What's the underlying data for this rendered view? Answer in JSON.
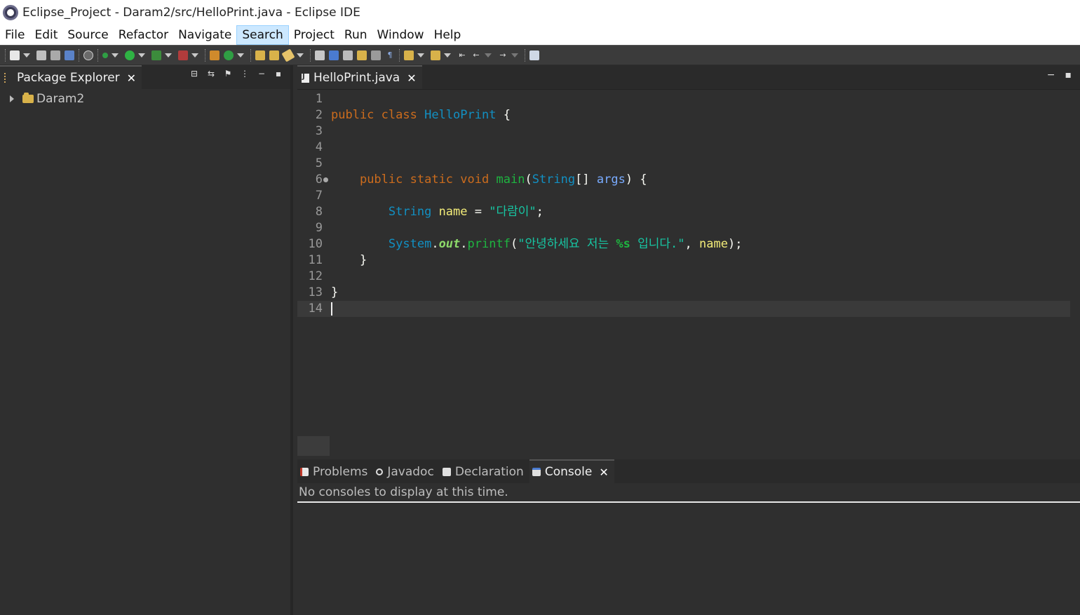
{
  "window": {
    "title": "Eclipse_Project - Daram2/src/HelloPrint.java - Eclipse IDE"
  },
  "menubar": {
    "items": [
      {
        "label": "File"
      },
      {
        "label": "Edit"
      },
      {
        "label": "Source"
      },
      {
        "label": "Refactor"
      },
      {
        "label": "Navigate"
      },
      {
        "label": "Search",
        "active": true
      },
      {
        "label": "Project"
      },
      {
        "label": "Run"
      },
      {
        "label": "Window"
      },
      {
        "label": "Help"
      }
    ]
  },
  "package_explorer": {
    "tab_label": "Package Explorer",
    "close_glyph": "✕",
    "tree": [
      {
        "label": "Daram2",
        "icon": "project-folder-icon",
        "expanded": false
      }
    ]
  },
  "editor": {
    "tab_label": "HelloPrint.java",
    "close_glyph": "✕",
    "line_numbers": [
      "1",
      "2",
      "3",
      "4",
      "5",
      "6",
      "7",
      "8",
      "9",
      "10",
      "11",
      "12",
      "13",
      "14"
    ],
    "current_line": 14,
    "code": {
      "l2_public": "public",
      "l2_class": "class",
      "l2_name": "HelloPrint",
      "l2_brace": "{",
      "l6_public": "public",
      "l6_static": "static",
      "l6_void": "void",
      "l6_main": "main",
      "l6_paren": "(",
      "l6_string": "String",
      "l6_arr": "[]",
      "l6_args": "args",
      "l6_close": ")",
      "l6_brace": "{",
      "l8_type": "String",
      "l8_var": "name",
      "l8_eq": "=",
      "l8_str": "\"다람이\"",
      "l8_semi": ";",
      "l10_sys": "System",
      "l10_dot1": ".",
      "l10_out": "out",
      "l10_dot2": ".",
      "l10_printf": "printf",
      "l10_open": "(",
      "l10_str1": "\"안녕하세요 저는 ",
      "l10_fmt": "%s",
      "l10_str2": " 입니다.\"",
      "l10_comma": ",",
      "l10_arg": "name",
      "l10_close": ");",
      "l11_brace": "}",
      "l13_brace": "}"
    }
  },
  "bottom_panel": {
    "tabs": [
      {
        "label": "Problems",
        "icon": "problems-icon",
        "active": false
      },
      {
        "label": "Javadoc",
        "icon": "javadoc-icon",
        "active": false
      },
      {
        "label": "Declaration",
        "icon": "declaration-icon",
        "active": false
      },
      {
        "label": "Console",
        "icon": "console-icon",
        "active": true
      }
    ],
    "close_glyph": "✕",
    "console_message": "No consoles to display at this time."
  },
  "colors": {
    "keyword": "#cc6c1d",
    "class_name": "#1290c3",
    "method": "#1eb540",
    "variable": "#f3ec79",
    "string": "#17c6a3",
    "background": "#2f2f2f"
  }
}
